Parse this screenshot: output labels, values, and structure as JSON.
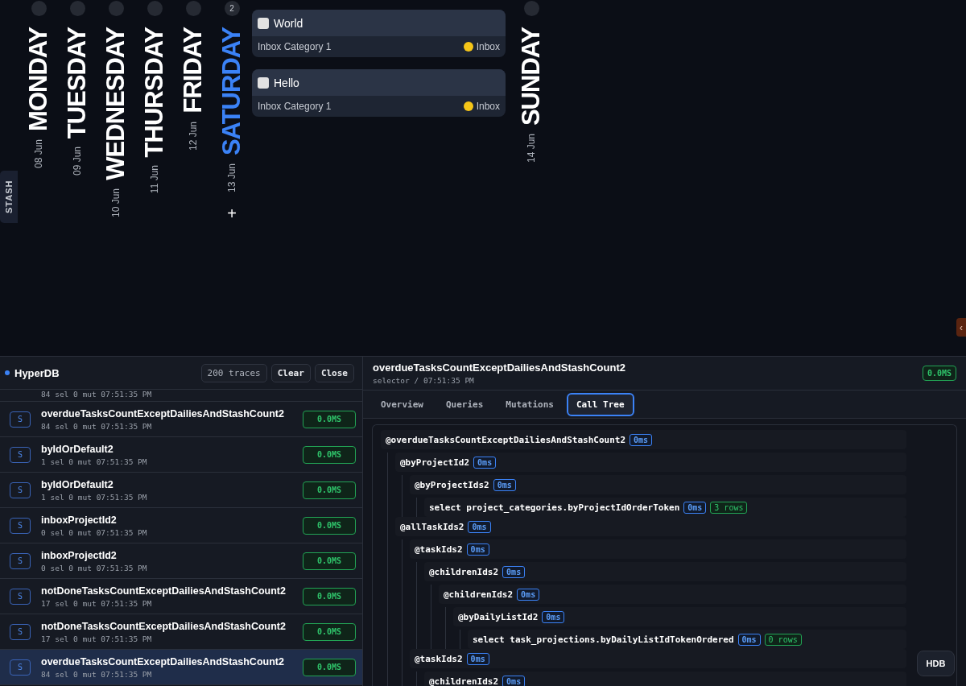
{
  "calendar": {
    "days": [
      {
        "name": "MONDAY",
        "date": "08 Jun",
        "selected": false
      },
      {
        "name": "TUESDAY",
        "date": "09 Jun",
        "selected": false
      },
      {
        "name": "WEDNESDAY",
        "date": "10 Jun",
        "selected": false
      },
      {
        "name": "THURSDAY",
        "date": "11 Jun",
        "selected": false
      },
      {
        "name": "FRIDAY",
        "date": "12 Jun",
        "selected": false
      },
      {
        "name": "SATURDAY",
        "date": "13 Jun",
        "selected": true,
        "count": "2",
        "add_button": "+",
        "tasks": [
          {
            "title": "World",
            "checked": false,
            "category": "Inbox Category 1",
            "project": "Inbox",
            "color": "#f5c518"
          },
          {
            "title": "Hello",
            "checked": false,
            "category": "Inbox Category 1",
            "project": "Inbox",
            "color": "#f5c518"
          }
        ]
      },
      {
        "name": "SUNDAY",
        "date": "14 Jun",
        "selected": false
      }
    ]
  },
  "stash_tab": "STASH",
  "side_toggle": "‹",
  "devtools": {
    "title": "HyperDB",
    "trace_count": "200 traces",
    "buttons": [
      "Clear",
      "Close"
    ],
    "traces": [
      {
        "meta": "84 sel 0 mut 07:51:35 PM",
        "selected": false
      },
      {
        "type": "S",
        "name": "overdueTasksCountExceptDailiesAndStashCount2",
        "meta": "84 sel 0 mut 07:51:35 PM",
        "duration": "0.0MS",
        "selected": false
      },
      {
        "type": "S",
        "name": "byIdOrDefault2",
        "meta": "1 sel 0 mut 07:51:35 PM",
        "duration": "0.0MS",
        "selected": false
      },
      {
        "type": "S",
        "name": "byIdOrDefault2",
        "meta": "1 sel 0 mut 07:51:35 PM",
        "duration": "0.0MS",
        "selected": false
      },
      {
        "type": "S",
        "name": "inboxProjectId2",
        "meta": "0 sel 0 mut 07:51:35 PM",
        "duration": "0.0MS",
        "selected": false
      },
      {
        "type": "S",
        "name": "inboxProjectId2",
        "meta": "0 sel 0 mut 07:51:35 PM",
        "duration": "0.0MS",
        "selected": false
      },
      {
        "type": "S",
        "name": "notDoneTasksCountExceptDailiesAndStashCount2",
        "meta": "17 sel 0 mut 07:51:35 PM",
        "duration": "0.0MS",
        "selected": false
      },
      {
        "type": "S",
        "name": "notDoneTasksCountExceptDailiesAndStashCount2",
        "meta": "17 sel 0 mut 07:51:35 PM",
        "duration": "0.0MS",
        "selected": false
      },
      {
        "type": "S",
        "name": "overdueTasksCountExceptDailiesAndStashCount2",
        "meta": "84 sel 0 mut 07:51:35 PM",
        "duration": "0.0MS",
        "selected": true
      }
    ],
    "detail": {
      "title": "overdueTasksCountExceptDailiesAndStashCount2",
      "subtitle": "selector / 07:51:35 PM",
      "duration": "0.0MS",
      "tabs": [
        {
          "label": "Overview",
          "selected": false
        },
        {
          "label": "Queries",
          "selected": false
        },
        {
          "label": "Mutations",
          "selected": false
        },
        {
          "label": "Call Tree",
          "selected": true
        }
      ],
      "call_tree": [
        {
          "label": "@overdueTasksCountExceptDailiesAndStashCount2",
          "duration": "0ms",
          "children": [
            {
              "label": "@byProjectId2",
              "duration": "0ms",
              "children": [
                {
                  "label": "@byProjectIds2",
                  "duration": "0ms",
                  "children": [
                    {
                      "label": "select project_categories.byProjectIdOrderToken",
                      "duration": "0ms",
                      "rows": "3 rows"
                    }
                  ]
                }
              ]
            },
            {
              "label": "@allTaskIds2",
              "duration": "0ms",
              "children": [
                {
                  "label": "@taskIds2",
                  "duration": "0ms",
                  "children": [
                    {
                      "label": "@childrenIds2",
                      "duration": "0ms",
                      "children": [
                        {
                          "label": "@childrenIds2",
                          "duration": "0ms",
                          "children": [
                            {
                              "label": "@byDailyListId2",
                              "duration": "0ms",
                              "children": [
                                {
                                  "label": "select task_projections.byDailyListIdTokenOrdered",
                                  "duration": "0ms",
                                  "rows": "0 rows"
                                }
                              ]
                            }
                          ]
                        }
                      ]
                    }
                  ]
                },
                {
                  "label": "@taskIds2",
                  "duration": "0ms",
                  "children": [
                    {
                      "label": "@childrenIds2",
                      "duration": "0ms"
                    }
                  ]
                }
              ]
            }
          ]
        }
      ]
    }
  },
  "hdb_button": "HDB"
}
